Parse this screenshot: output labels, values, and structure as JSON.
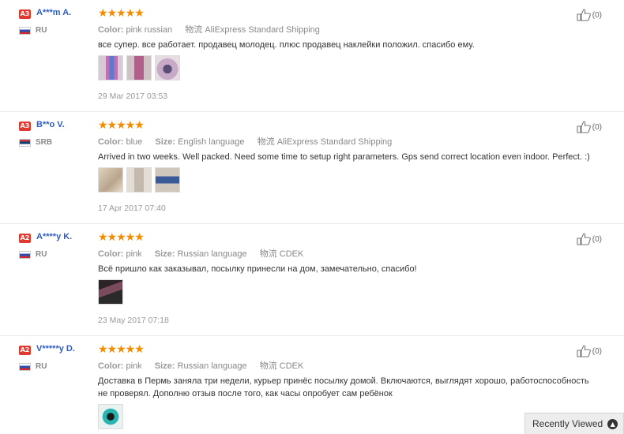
{
  "reviews": [
    {
      "badge": "A3",
      "name": "A***m A.",
      "country": "RU",
      "flag": "ru",
      "stars": "★★★★★",
      "color_label": "Color:",
      "color": "pink russian",
      "shipping_icon": "物流",
      "shipping": "AliExpress Standard Shipping",
      "text": "все супер. все работает. продавец молодец. плюс продавец наклейки положил. спасибо ему.",
      "photos": [
        "pink-watch-photo",
        "pink-watch-strap-photo",
        "watch-package-photo"
      ],
      "date": "29 Mar 2017 03:53",
      "helpful": "(0)"
    },
    {
      "badge": "A3",
      "name": "B**o V.",
      "country": "SRB",
      "flag": "rs",
      "stars": "★★★★★",
      "color_label": "Color:",
      "color": "blue",
      "size_label": "Size:",
      "size": "English language",
      "shipping_icon": "物流",
      "shipping": "AliExpress Standard Shipping",
      "text": "Arrived in two weeks. Well packed. Need some time to setup right parameters. Gps send correct location even indoor. Perfect. :)",
      "photos": [
        "box-photo",
        "watch-in-hand-photo",
        "blue-watch-photo"
      ],
      "date": "17 Apr 2017 07:40",
      "helpful": "(0)"
    },
    {
      "badge": "A2",
      "name": "A****y K.",
      "country": "RU",
      "flag": "ru",
      "stars": "★★★★★",
      "color_label": "Color:",
      "color": "pink",
      "size_label": "Size:",
      "size": "Russian language",
      "shipping_icon": "物流",
      "shipping": "CDEK",
      "text": "Всё пришло как заказывал, посылку принесли на дом, замечательно, спасибо!",
      "photos": [
        "watch-on-wrist-photo"
      ],
      "date": "23 May 2017 07:18",
      "helpful": "(0)"
    },
    {
      "badge": "A2",
      "name": "V*****y D.",
      "country": "RU",
      "flag": "ru",
      "stars": "★★★★★",
      "color_label": "Color:",
      "color": "pink",
      "size_label": "Size:",
      "size": "Russian language",
      "shipping_icon": "物流",
      "shipping": "CDEK",
      "text": "Доставка в Пермь заняла три недели, курьер принёс посылку домой. Включаются, выглядят хорошо, работоспособность не проверял. Дополню отзыв после того, как часы опробует сам ребёнок",
      "photos": [
        "teal-watch-photo"
      ],
      "date": "",
      "helpful": "(0)"
    }
  ],
  "recently_viewed": {
    "label": "Recently Viewed",
    "icon": "chevron-up-icon"
  },
  "colors": {
    "star": "#f78b00",
    "username": "#2c5cc5",
    "badge": "#e03a2f"
  }
}
